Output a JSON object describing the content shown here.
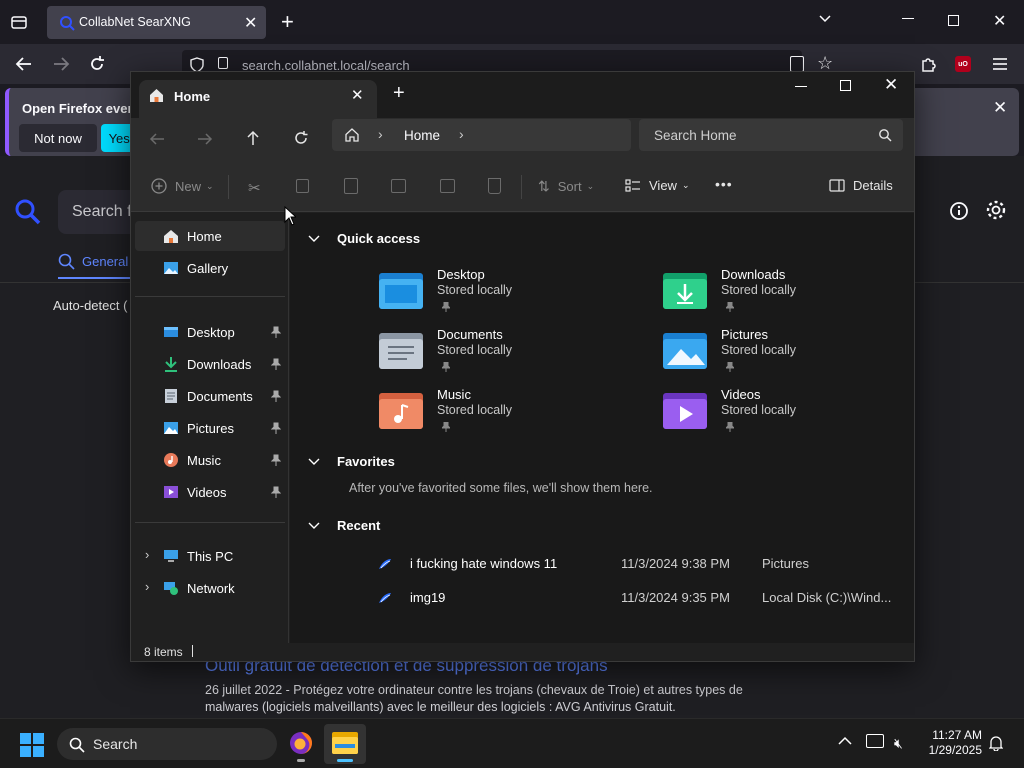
{
  "browser": {
    "tab_title": "CollabNet SearXNG",
    "url": "search.collabnet.local/search",
    "notice_text": "Open Firefox every",
    "not_now": "Not now",
    "yes": "Yes,"
  },
  "search_page": {
    "search_placeholder": "Search f",
    "general_tab": "General",
    "auto_detect": "Auto-detect (",
    "result_title": "Outil gratuit de détection et de suppression de trojans",
    "result_snippet_1": "26 juillet 2022 - Protégez votre ordinateur contre les trojans (chevaux de Troie) et autres types de",
    "result_snippet_2": "malwares (logiciels malveillants) avec le meilleur des logiciels : AVG Antivirus Gratuit."
  },
  "explorer": {
    "tab_title": "Home",
    "breadcrumb": "Home",
    "search_placeholder": "Search Home",
    "toolbar": {
      "new": "New",
      "sort": "Sort",
      "view": "View",
      "more": "•••",
      "details": "Details"
    },
    "nav": {
      "home": "Home",
      "gallery": "Gallery",
      "desktop": "Desktop",
      "downloads": "Downloads",
      "documents": "Documents",
      "pictures": "Pictures",
      "music": "Music",
      "videos": "Videos",
      "this_pc": "This PC",
      "network": "Network"
    },
    "quick_access_title": "Quick access",
    "quick_access": [
      {
        "name": "Desktop",
        "status": "Stored locally"
      },
      {
        "name": "Downloads",
        "status": "Stored locally"
      },
      {
        "name": "Documents",
        "status": "Stored locally"
      },
      {
        "name": "Pictures",
        "status": "Stored locally"
      },
      {
        "name": "Music",
        "status": "Stored locally"
      },
      {
        "name": "Videos",
        "status": "Stored locally"
      }
    ],
    "favorites_title": "Favorites",
    "favorites_empty": "After you've favorited some files, we'll show them here.",
    "recent_title": "Recent",
    "recent": [
      {
        "name": "i fucking hate windows 11",
        "date": "11/3/2024 9:38 PM",
        "location": "Pictures"
      },
      {
        "name": "img19",
        "date": "11/3/2024 9:35 PM",
        "location": "Local Disk (C:)\\Wind..."
      }
    ],
    "status": "8 items"
  },
  "taskbar": {
    "search": "Search",
    "time": "11:27 AM",
    "date": "1/29/2025"
  },
  "colors": {
    "accent": "#4cc2ff",
    "firefox_accent": "#00ddff",
    "folder_blue": "#2b8de0"
  }
}
